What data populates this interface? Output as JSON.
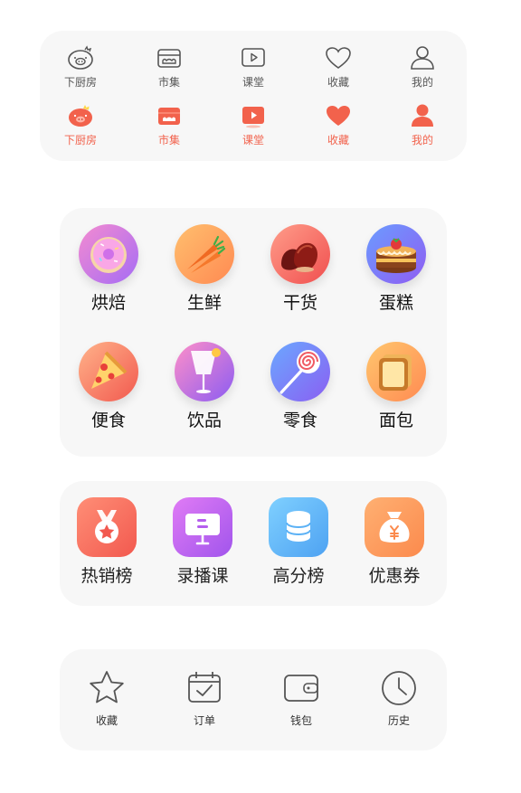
{
  "tabbar_outline": {
    "items": [
      {
        "label": "下厨房",
        "icon": "pig-chef-icon"
      },
      {
        "label": "市集",
        "icon": "market-stall-icon"
      },
      {
        "label": "课堂",
        "icon": "video-play-icon"
      },
      {
        "label": "收藏",
        "icon": "heart-icon"
      },
      {
        "label": "我的",
        "icon": "person-icon"
      }
    ],
    "color": "#555555"
  },
  "tabbar_filled": {
    "items": [
      {
        "label": "下厨房",
        "icon": "pig-chef-icon"
      },
      {
        "label": "市集",
        "icon": "market-stall-icon"
      },
      {
        "label": "课堂",
        "icon": "video-play-icon"
      },
      {
        "label": "收藏",
        "icon": "heart-icon"
      },
      {
        "label": "我的",
        "icon": "person-icon"
      }
    ],
    "color": "#f2624c"
  },
  "categories": {
    "items": [
      {
        "label": "烘焙",
        "icon": "donut-icon"
      },
      {
        "label": "生鲜",
        "icon": "carrot-icon"
      },
      {
        "label": "干货",
        "icon": "chestnut-icon"
      },
      {
        "label": "蛋糕",
        "icon": "cake-icon"
      },
      {
        "label": "便食",
        "icon": "pizza-icon"
      },
      {
        "label": "饮品",
        "icon": "cocktail-icon"
      },
      {
        "label": "零食",
        "icon": "lollipop-icon"
      },
      {
        "label": "面包",
        "icon": "toast-icon"
      }
    ]
  },
  "quick_links": {
    "items": [
      {
        "label": "热销榜",
        "icon": "medal-icon",
        "color": "#f46a5a"
      },
      {
        "label": "录播课",
        "icon": "presentation-board-icon",
        "color": "#c162f0"
      },
      {
        "label": "高分榜",
        "icon": "coin-stack-icon",
        "color": "#5bb7f7"
      },
      {
        "label": "优惠券",
        "icon": "money-bag-icon",
        "color": "#fb9a5a"
      }
    ]
  },
  "mine_menu": {
    "items": [
      {
        "label": "收藏",
        "icon": "star-icon"
      },
      {
        "label": "订单",
        "icon": "calendar-check-icon"
      },
      {
        "label": "钱包",
        "icon": "wallet-icon"
      },
      {
        "label": "历史",
        "icon": "clock-icon"
      }
    ]
  }
}
